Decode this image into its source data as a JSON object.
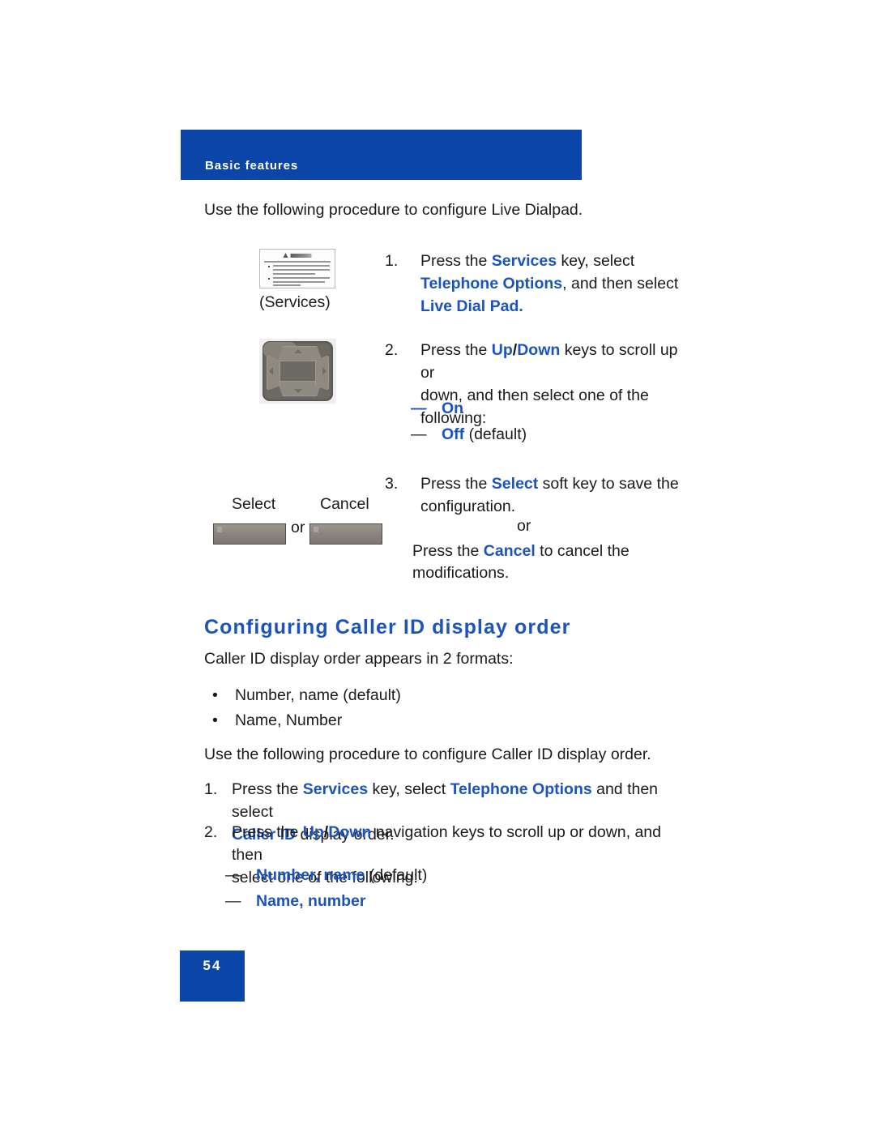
{
  "header": {
    "banner_title": "Basic features",
    "banner_color": "#0b45a8"
  },
  "intro_text": "Use the following procedure to configure Live Dialpad.",
  "accent_blue": "#1b54bc",
  "live_dialpad_steps": [
    {
      "number": "1.",
      "line1_a": "Press the ",
      "line1_b": "Services",
      "line1_c": " key, select",
      "line2_b": "Telephone Options",
      "line2_c": ", and then select",
      "line3_b": "Live Dial Pad."
    },
    {
      "number": "2.",
      "line1_a": "Press the ",
      "line1_b1": "Up",
      "line1_slash": "/",
      "line1_b2": "Down",
      "line1_c": " keys to scroll up or",
      "line2": "down, and then select one of the",
      "line3": "following:"
    },
    {
      "number": "3.",
      "line1_a": "Press the ",
      "line1_b": "Select",
      "line1_c": " soft key to save the",
      "line2": "configuration.",
      "or": "or",
      "line3_a": "Press the ",
      "line3_b": "Cancel",
      "line3_c": " to cancel the",
      "line4": "modifications."
    }
  ],
  "live_dialpad_options": [
    {
      "dash": "—",
      "label": "On",
      "suffix": ""
    },
    {
      "dash": "—",
      "label": "Off",
      "suffix": " (default)"
    }
  ],
  "services_caption": "(Services)",
  "softkeys": {
    "select_label": "Select",
    "cancel_label": "Cancel",
    "or": "or"
  },
  "caller_id_section": {
    "heading": "Configuring Caller ID display order",
    "intro": "Caller ID display order appears in 2 formats:",
    "formats": [
      {
        "bullet": "•",
        "label": "Number, name (default)"
      },
      {
        "bullet": "•",
        "label": "Name, Number"
      }
    ],
    "procedure_intro": "Use the following procedure to configure Caller ID display order.",
    "steps": [
      {
        "number": "1.",
        "line1_a": "Press the ",
        "line1_b": "Services",
        "line1_c": " key, select ",
        "line1_d": "Telephone Options",
        "line1_e": " and then select",
        "line2_b": "Caller ID",
        "line2_c": " display order."
      },
      {
        "number": "2.",
        "line1_a": "Press the ",
        "line1_b1": "Up",
        "line1_slash": "/",
        "line1_b2": "Down",
        "line1_c": " navigation keys to scroll up or down, and then",
        "line2": "select one of the following:"
      }
    ],
    "options": [
      {
        "dash": "—",
        "label": "Number, name",
        "suffix": " (default)"
      },
      {
        "dash": "—",
        "label": "Name, number",
        "suffix": ""
      }
    ]
  },
  "footer": {
    "page_number": "54"
  }
}
